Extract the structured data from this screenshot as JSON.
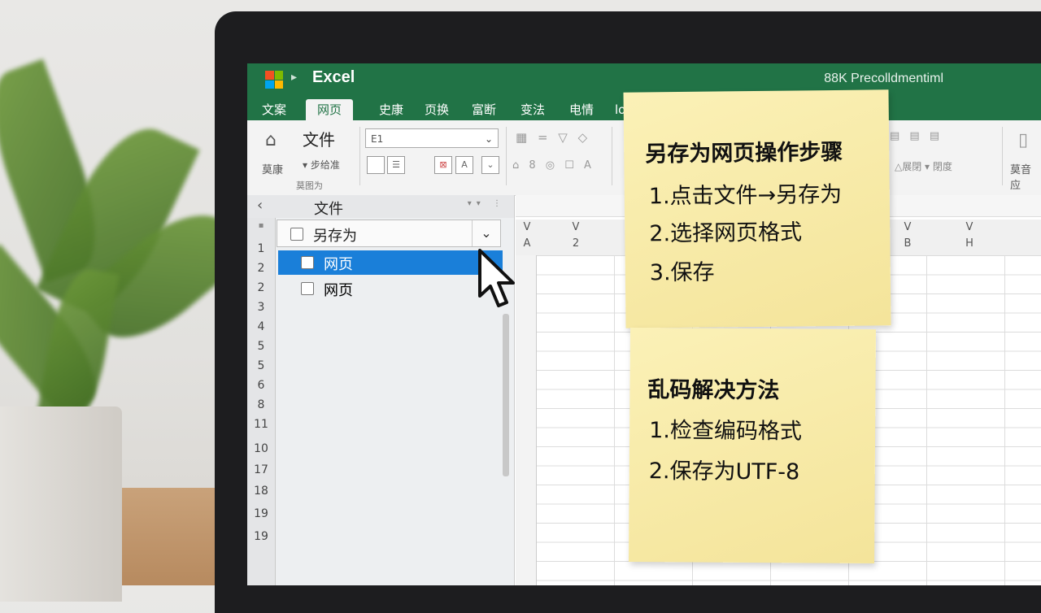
{
  "window": {
    "app_title": "Excel",
    "doc_title": "88K Precolldmentiml"
  },
  "tabs": [
    {
      "label": "文案",
      "active": false
    },
    {
      "label": "网页",
      "active": true
    },
    {
      "label": "史康",
      "active": false
    },
    {
      "label": "页换",
      "active": false
    },
    {
      "label": "富断",
      "active": false
    },
    {
      "label": "变法",
      "active": false
    },
    {
      "label": "电情",
      "active": false
    },
    {
      "label": "lo",
      "active": false
    }
  ],
  "ribbon": {
    "home_label": "莫康",
    "file_label": "文件",
    "file_sub": "▾ 步给准",
    "group_label": "莫图为",
    "combo_value": "E1",
    "right_label": "莫音应",
    "right_combo": "△展閉 ▾ 閉度"
  },
  "panel": {
    "title": "文件",
    "row_numbers": [
      "1",
      "2",
      "2",
      "3",
      "4",
      "5",
      "5",
      "6",
      "8",
      "11",
      "10",
      "17",
      "18",
      "19",
      "19"
    ],
    "dropdown_value": "另存为",
    "options": [
      {
        "label": "网页",
        "selected": true
      },
      {
        "label": "网页",
        "selected": false
      }
    ]
  },
  "grid": {
    "col_top": [
      "V",
      "V",
      "V",
      "V"
    ],
    "col_bottom": [
      "A",
      "2",
      "B",
      "H"
    ]
  },
  "notes": {
    "steps": {
      "title": "另存为网页操作步骤",
      "items": [
        "1.点击文件→另存为",
        "2.选择网页格式",
        "3.保存"
      ]
    },
    "fix": {
      "title": "乱码解决方法",
      "items": [
        "1.检查编码格式",
        "2.保存为UTF-8"
      ]
    }
  },
  "colors": {
    "excel_green": "#217346",
    "selection_blue": "#1a7fd9",
    "sticky_yellow": "#f6e7a2"
  }
}
